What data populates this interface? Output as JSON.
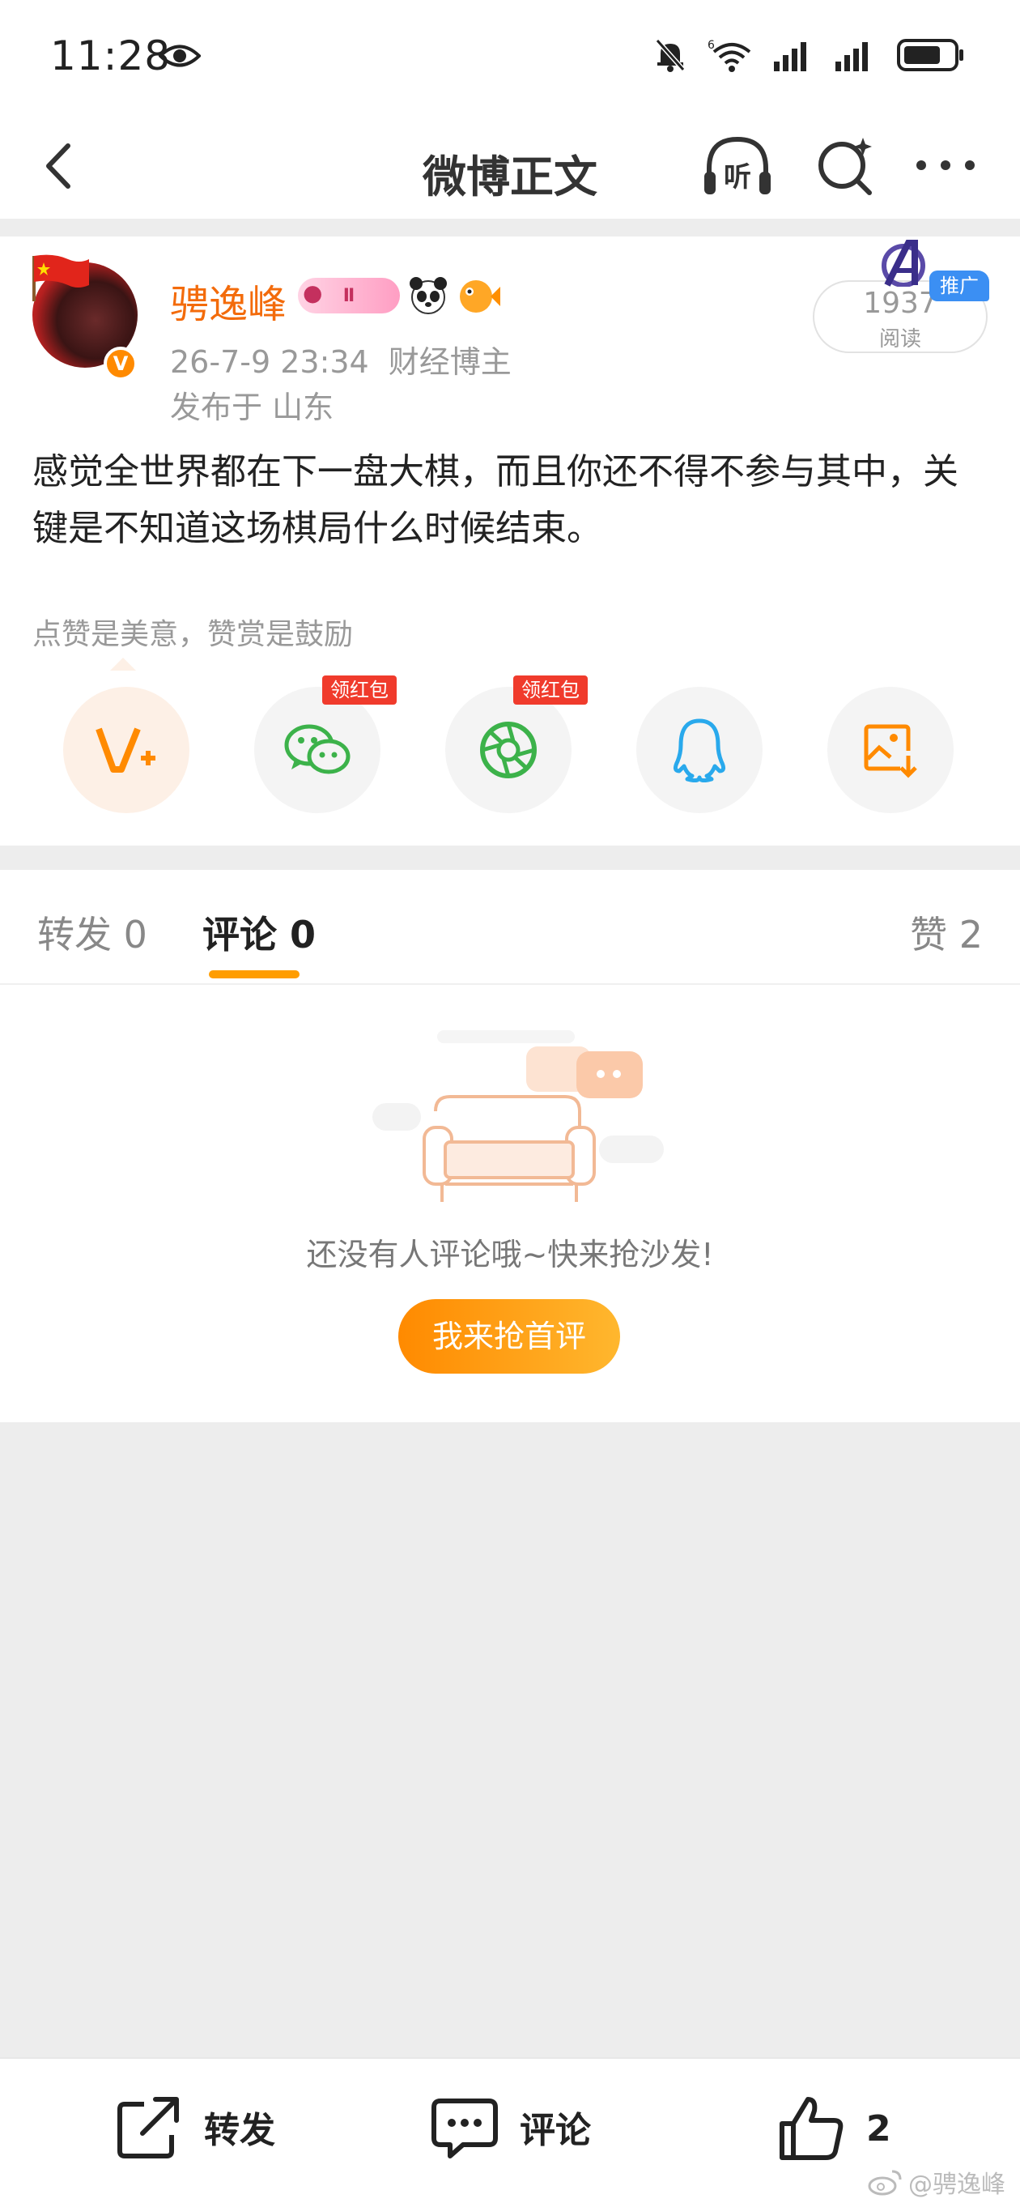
{
  "status_bar": {
    "time": "11:28",
    "network": "6"
  },
  "nav": {
    "title": "微博正文",
    "listen_label": "听"
  },
  "post": {
    "username": "骋逸峰",
    "level_badge": "Ⅱ",
    "date": "26-7-9 23:34",
    "role": "财经博主",
    "location": "发布于 山东",
    "read_count": "1937",
    "read_label": "阅读",
    "promo_tag": "推广",
    "text": "感觉全世界都在下一盘大棋，而且你还不得不参与其中，关键是不知道这场棋局什么时候结束。",
    "reward_hint": "点赞是美意，赞赏是鼓励",
    "share_buttons": [
      {
        "icon": "v-plus-icon",
        "tag": ""
      },
      {
        "icon": "wechat-icon",
        "tag": "领红包"
      },
      {
        "icon": "moments-icon",
        "tag": "领红包"
      },
      {
        "icon": "qq-icon",
        "tag": ""
      },
      {
        "icon": "save-image-icon",
        "tag": ""
      }
    ]
  },
  "tabs": {
    "repost": "转发 0",
    "comment": "评论 0",
    "like": "赞 2"
  },
  "empty_state": {
    "message": "还没有人评论哦~快来抢沙发!",
    "button": "我来抢首评"
  },
  "bottom_bar": {
    "repost": "转发",
    "comment": "评论",
    "like_count": "2"
  },
  "watermark": "@骋逸峰",
  "colors": {
    "accent": "#ff8a00",
    "username": "#f36b0b",
    "promo": "#3b8ff3",
    "red_tag": "#f03b2c"
  }
}
